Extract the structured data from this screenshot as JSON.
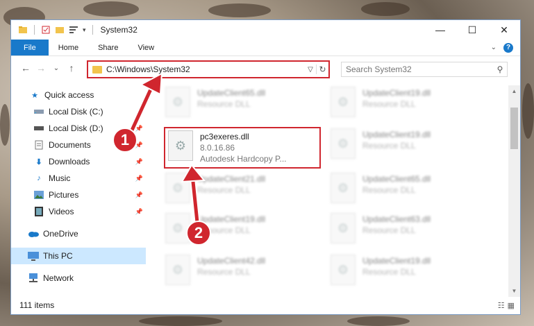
{
  "window": {
    "title": "System32",
    "controls": {
      "minimize": "—",
      "maximize": "☐",
      "close": "✕"
    }
  },
  "ribbon": {
    "tabs": [
      "File",
      "Home",
      "Share",
      "View"
    ],
    "expand_icon": "chevron-down-icon",
    "help": "?"
  },
  "nav": {
    "back": "←",
    "forward": "→",
    "recent": "⌄",
    "up": "↑",
    "address": "C:\\Windows\\System32",
    "search_placeholder": "Search System32"
  },
  "sidebar": {
    "items": [
      {
        "label": "Quick access",
        "icon": "star-icon",
        "pinned": false
      },
      {
        "label": "Local Disk (C:)",
        "icon": "drive-icon",
        "pinned": false
      },
      {
        "label": "Local Disk (D:)",
        "icon": "drive-icon",
        "pinned": true
      },
      {
        "label": "Documents",
        "icon": "documents-icon",
        "pinned": true
      },
      {
        "label": "Downloads",
        "icon": "download-icon",
        "pinned": true
      },
      {
        "label": "Music",
        "icon": "music-icon",
        "pinned": true
      },
      {
        "label": "Pictures",
        "icon": "pictures-icon",
        "pinned": true
      },
      {
        "label": "Videos",
        "icon": "videos-icon",
        "pinned": true
      },
      {
        "label": "OneDrive",
        "icon": "cloud-icon",
        "pinned": false
      },
      {
        "label": "This PC",
        "icon": "computer-icon",
        "pinned": false,
        "selected": true
      },
      {
        "label": "Network",
        "icon": "network-icon",
        "pinned": false
      }
    ]
  },
  "files": {
    "left": [
      {
        "name": "UpdateClient65.dll",
        "type": "Resource DLL",
        "blurred": true
      },
      {
        "name": "pc3exeres.dll",
        "version": "8.0.16.86",
        "desc": "Autodesk Hardcopy P...",
        "blurred": false,
        "highlighted": true
      },
      {
        "name": "UpdateClient21.dll",
        "type": "Resource DLL",
        "blurred": true
      },
      {
        "name": "UpdateClient19.dll",
        "type": "Resource DLL",
        "blurred": true
      },
      {
        "name": "UpdateClient42.dll",
        "type": "Resource DLL",
        "blurred": true
      }
    ],
    "right": [
      {
        "name": "UpdateClient19.dll",
        "type": "Resource DLL"
      },
      {
        "name": "UpdateClient19.dll",
        "type": "Resource DLL"
      },
      {
        "name": "UpdateClient65.dll",
        "type": "Resource DLL"
      },
      {
        "name": "UpdateClient63.dll",
        "type": "Resource DLL"
      },
      {
        "name": "UpdateClient19.dll",
        "type": "Resource DLL"
      }
    ]
  },
  "status": {
    "count": "111 items"
  },
  "callouts": [
    "1",
    "2"
  ],
  "colors": {
    "accent": "#1979ca",
    "highlight": "#d0262e",
    "selected": "#cce8ff"
  }
}
